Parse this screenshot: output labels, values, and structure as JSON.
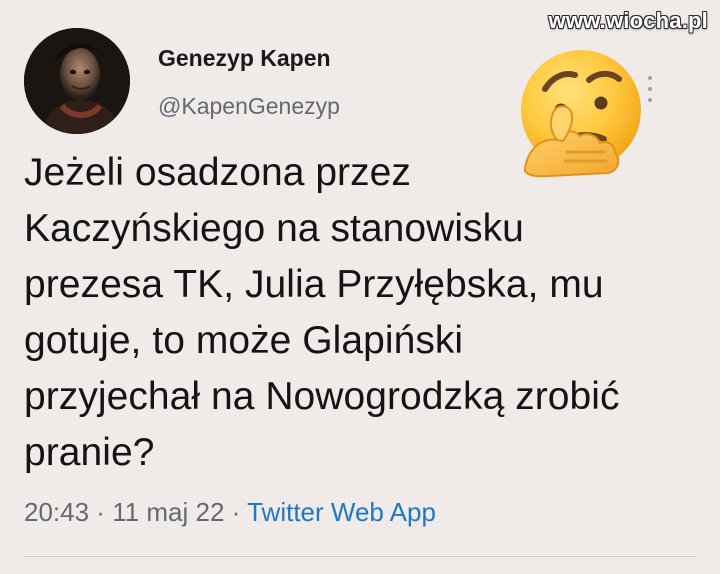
{
  "watermark": "www.wiocha.pl",
  "user": {
    "name": "Genezyp Kapen",
    "handle": "@KapenGenezyp"
  },
  "tweet": {
    "text": "Jeżeli osadzona przez\nKaczyńskiego na stanowisku\nprezesa TK, Julia Przyłębska, mu\ngotuje, to może Glapiński\nprzyjechał na Nowogrodzką zrobić\npranie?"
  },
  "meta": {
    "time": "20:43",
    "separator1": " · ",
    "date": "11 maj 22",
    "separator2": " · ",
    "source": "Twitter Web App"
  },
  "icons": {
    "menu": "more-vertical-icon",
    "emoji": "thinking-face-emoji"
  },
  "colors": {
    "background": "#f0ebe8",
    "link": "#1d79c2",
    "muted": "#5f6a74"
  }
}
